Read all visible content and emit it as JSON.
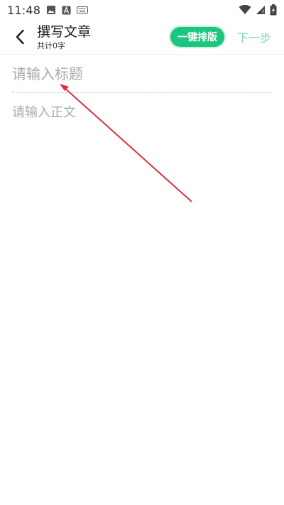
{
  "status_bar": {
    "time": "11:48",
    "icons": [
      "image-icon",
      "font-icon",
      "keyboard-icon",
      "wifi-icon",
      "signal-icon",
      "battery-icon"
    ]
  },
  "header": {
    "back_icon": "back-arrow-icon",
    "title": "撰写文章",
    "word_count": "共计0字",
    "format_button_label": "一键排版",
    "next_button_label": "下一步"
  },
  "editor": {
    "title_value": "",
    "title_placeholder": "请输入标题",
    "body_value": "",
    "body_placeholder": "请输入正文"
  },
  "colors": {
    "accent_green": "#1dc67f",
    "next_green": "#7fdcae",
    "placeholder_gray": "#a9a9a9",
    "annotation_red": "#d9323a"
  }
}
